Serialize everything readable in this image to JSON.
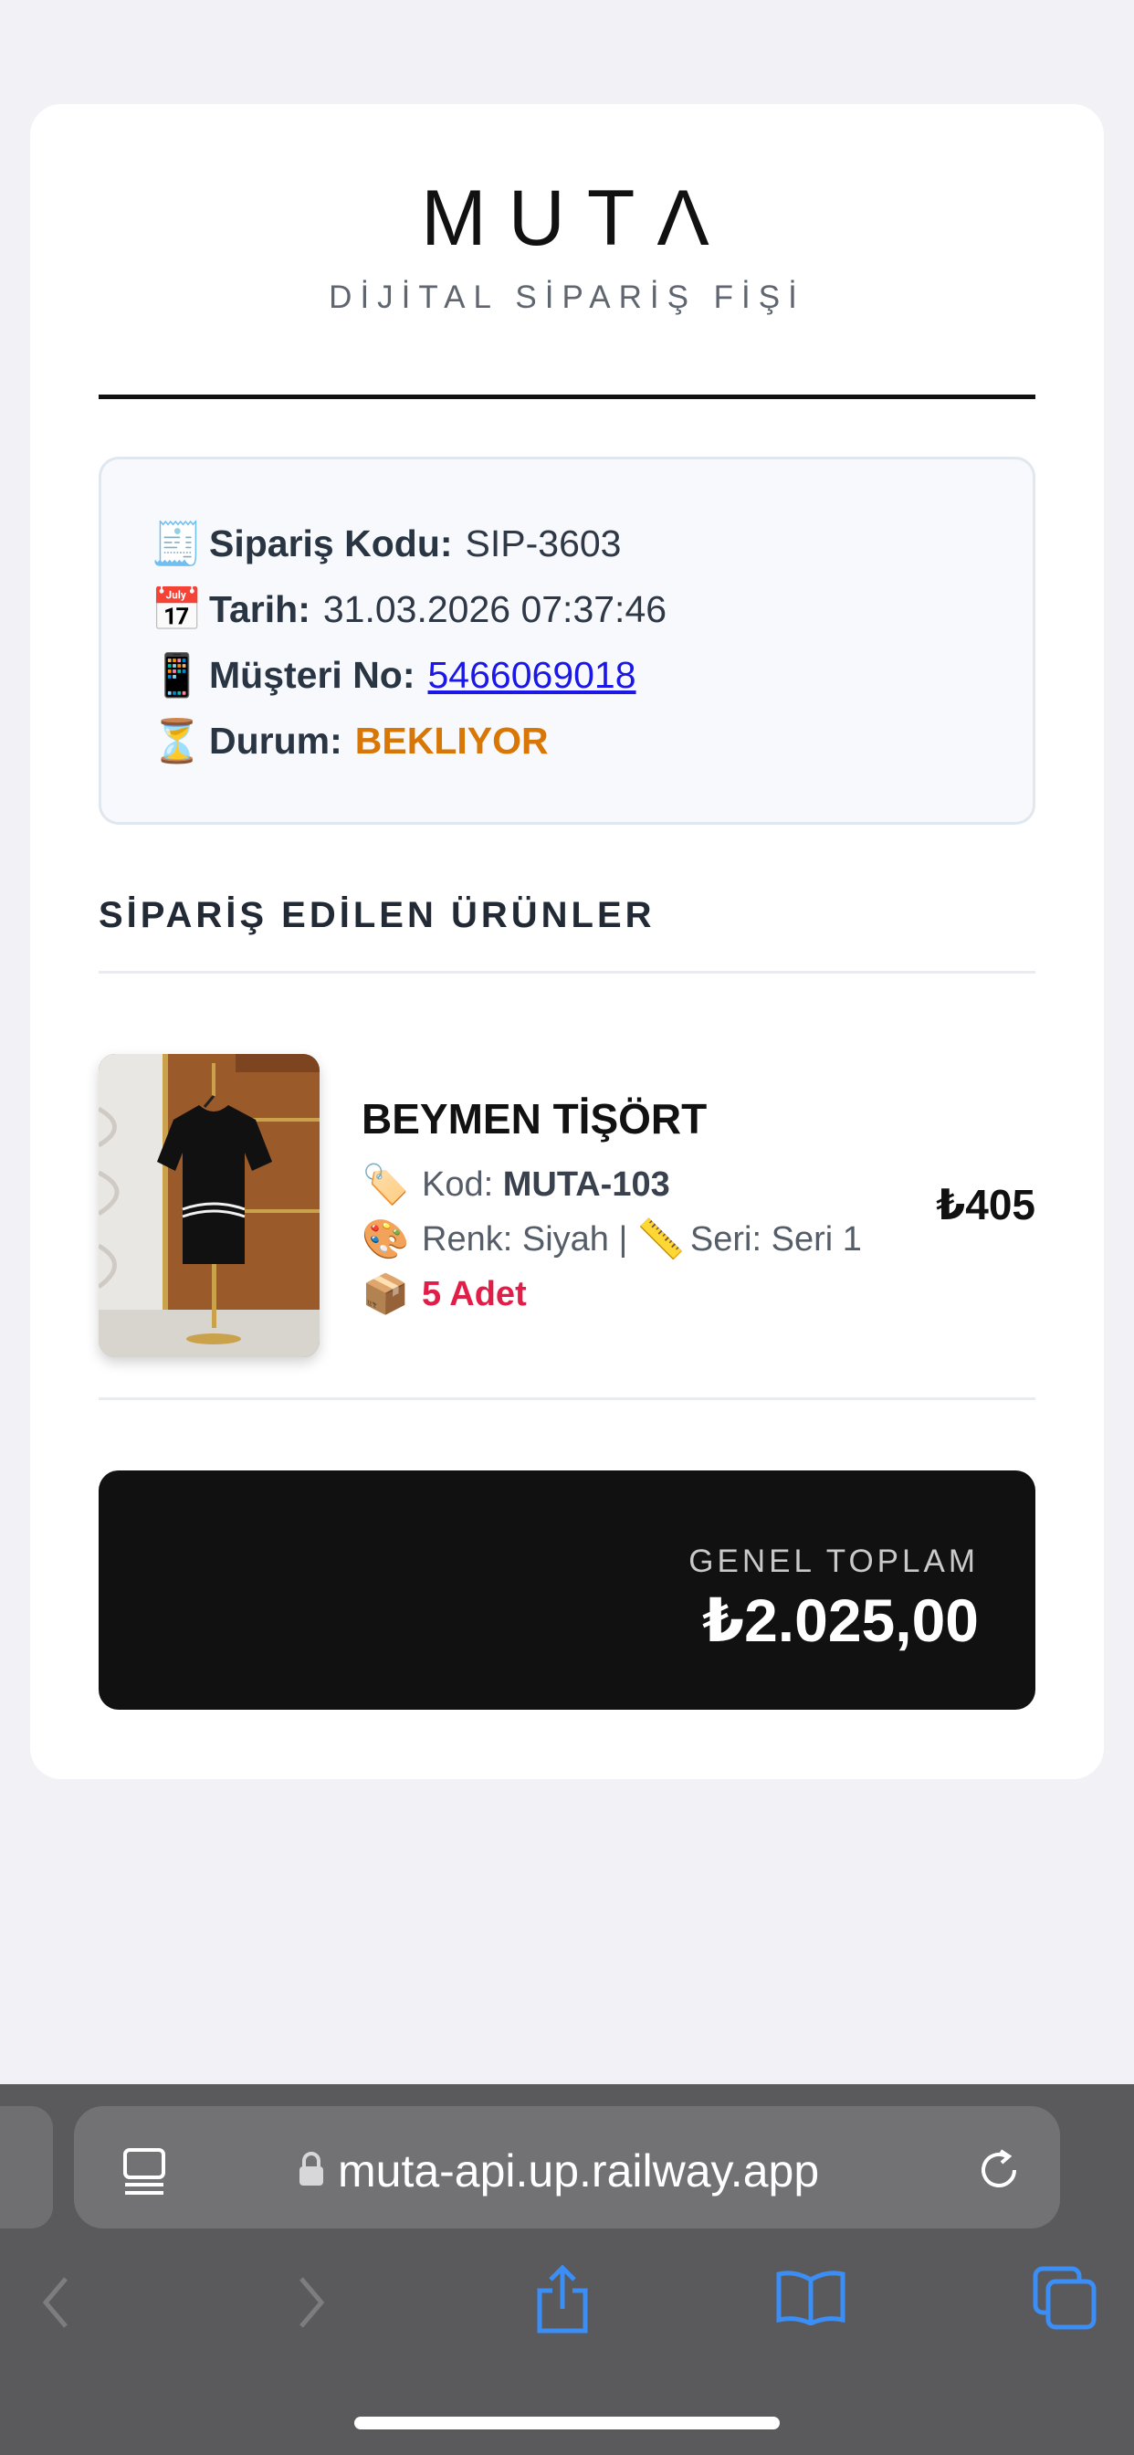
{
  "receipt": {
    "brand": "MUTΛ",
    "subtitle": "DİJİTAL SİPARİŞ FİŞİ",
    "info": {
      "order_code_label": "Sipariş Kodu:",
      "order_code": "SIP-3603",
      "date_label": "Tarih:",
      "date": "31.03.2026 07:37:46",
      "customer_label": "Müşteri No:",
      "customer_no": "5466069018",
      "status_label": "Durum:",
      "status": "BEKLIYOR",
      "status_color": "#d97706"
    },
    "items_title": "SİPARİŞ EDİLEN ÜRÜNLER",
    "item": {
      "name": "BEYMEN TİŞÖRT",
      "code_label": "Kod:",
      "code": "MUTA-103",
      "color_label": "Renk:",
      "color": "Siyah",
      "separator": "|",
      "series_label": "Seri:",
      "series": "Seri 1",
      "quantity": "5 Adet",
      "price": "₺405"
    },
    "total_label": "GENEL TOPLAM",
    "total_value": "₺2.025,00"
  },
  "browser": {
    "url": "muta-api.up.railway.app",
    "icons": {
      "reader": "reader-mode-icon",
      "lock": "lock-icon",
      "reload": "reload-icon",
      "back": "back-icon",
      "forward": "forward-icon",
      "share": "share-icon",
      "bookmarks": "bookmarks-icon",
      "tabs": "tabs-icon"
    },
    "accent_color": "#3a8ef6"
  }
}
